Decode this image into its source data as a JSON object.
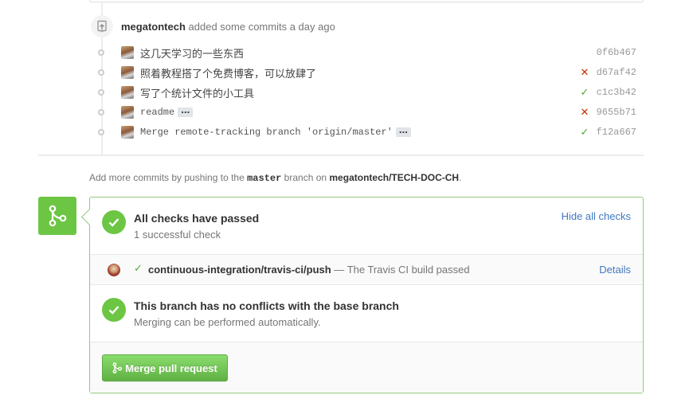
{
  "push": {
    "author": "megatontech",
    "action": "added some commits",
    "time": "a day ago"
  },
  "commits": [
    {
      "message": "这几天学习的一些东西",
      "mono": false,
      "has_more": false,
      "status": "none",
      "sha": "0f6b467"
    },
    {
      "message": "照着教程搭了个免费博客，可以放肆了",
      "mono": false,
      "has_more": false,
      "status": "fail",
      "sha": "d67af42"
    },
    {
      "message": "写了个统计文件的小工具",
      "mono": false,
      "has_more": false,
      "status": "pass",
      "sha": "c1c3b42"
    },
    {
      "message": "readme",
      "mono": true,
      "has_more": true,
      "status": "fail",
      "sha": "9655b71"
    },
    {
      "message": "Merge remote-tracking branch 'origin/master'",
      "mono": true,
      "has_more": true,
      "status": "pass",
      "sha": "f12a667"
    }
  ],
  "ellipsis_label": "…",
  "status_glyphs": {
    "fail": "✕",
    "pass": "✓",
    "none": ""
  },
  "hint": {
    "prefix": "Add more commits by pushing to the",
    "branch": "master",
    "middle": "branch on",
    "repo": "megatontech/TECH-DOC-CH",
    "suffix": "."
  },
  "checks": {
    "title": "All checks have passed",
    "subtitle": "1 successful check",
    "hide_label": "Hide all checks",
    "item": {
      "name": "continuous-integration/travis-ci/push",
      "separator": " — ",
      "description": "The Travis CI build passed",
      "details_label": "Details"
    }
  },
  "conflicts": {
    "title": "This branch has no conflicts with the base branch",
    "subtitle": "Merging can be performed automatically."
  },
  "merge_button": {
    "label": "Merge pull request"
  },
  "colors": {
    "success": "#6cc644",
    "fail": "#bd2c00",
    "link": "#4078c0",
    "merge_border": "#95c97e"
  },
  "icons": {
    "push": "repo-push-icon",
    "merge": "git-merge-icon",
    "check": "check-icon",
    "fail": "x-icon"
  }
}
